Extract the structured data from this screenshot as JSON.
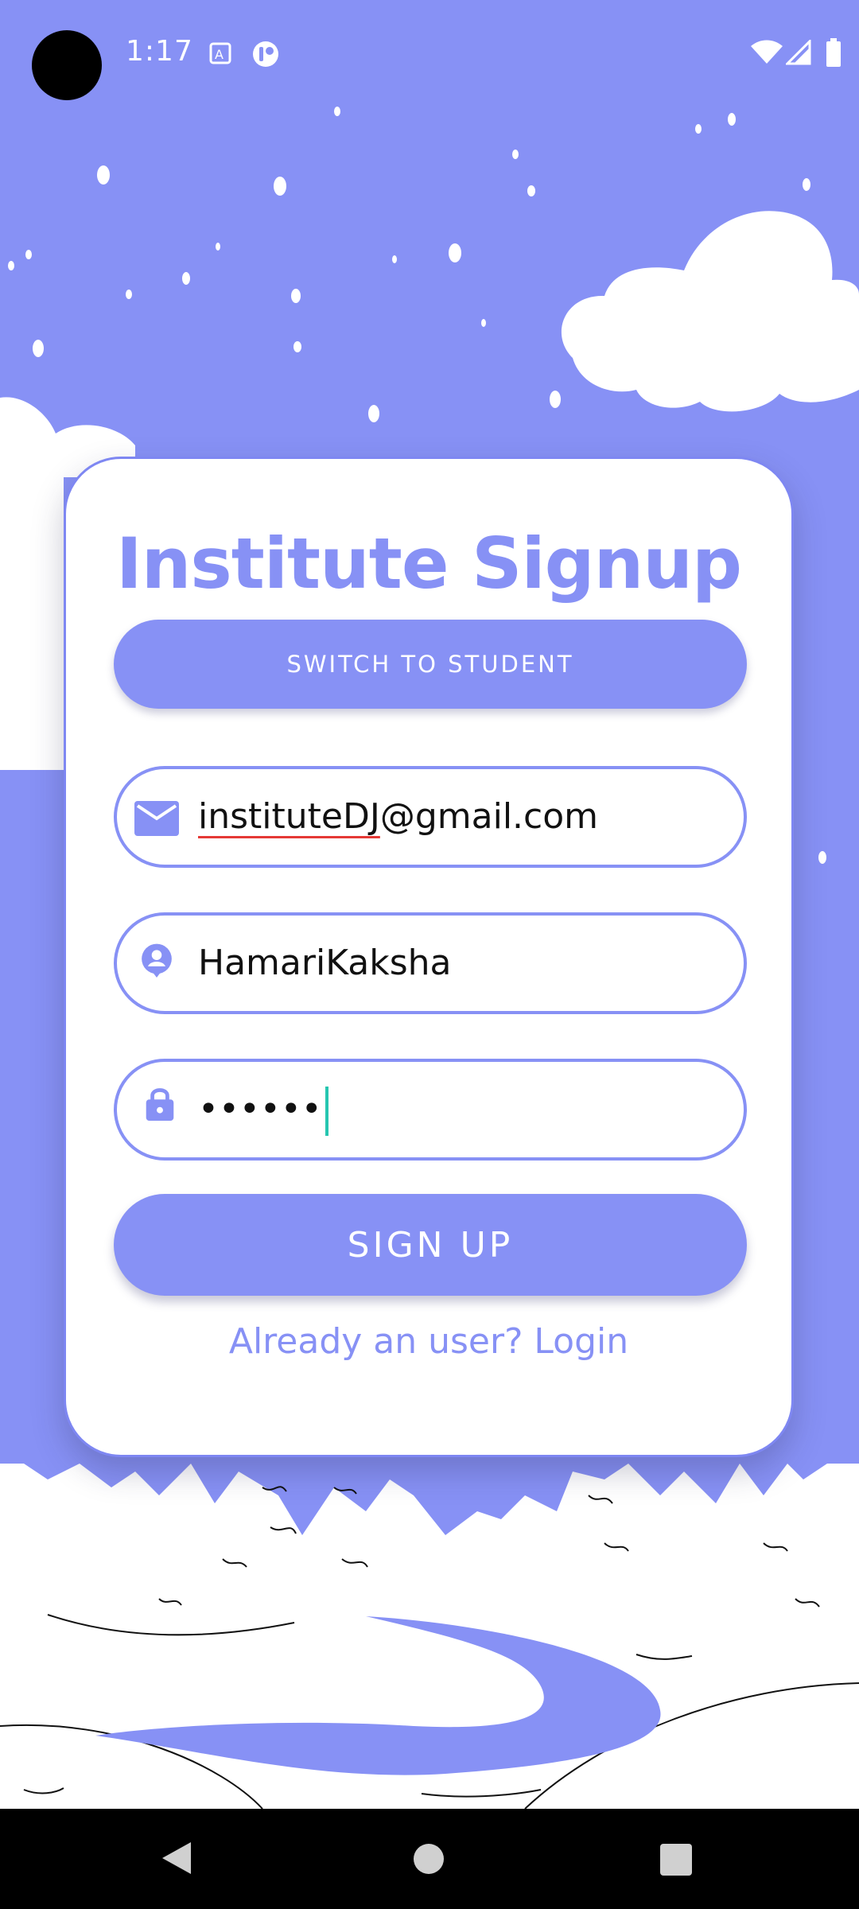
{
  "status_bar": {
    "time": "1:17",
    "icons": [
      "text-recognition-icon",
      "app-notification-icon",
      "wifi-icon",
      "signal-icon",
      "battery-icon"
    ]
  },
  "card": {
    "title": "Institute Signup",
    "switch_button": "SWITCH TO STUDENT",
    "email": {
      "icon": "envelope-icon",
      "value_underlined": "instituteDJ",
      "value_rest": "@gmail.com"
    },
    "username": {
      "icon": "user-icon",
      "value": "HamariKaksha"
    },
    "password": {
      "icon": "lock-icon",
      "value": "••••••"
    },
    "signup_button": "SIGN UP",
    "login_link": "Already an user? Login"
  },
  "colors": {
    "accent": "#8791f5",
    "background": "#8791f5",
    "card": "#ffffff",
    "cursor": "#26c6b0",
    "spellcheck_underline": "#e53935"
  },
  "nav_bar": {
    "icons": [
      "back-icon",
      "home-icon",
      "recents-icon"
    ]
  }
}
